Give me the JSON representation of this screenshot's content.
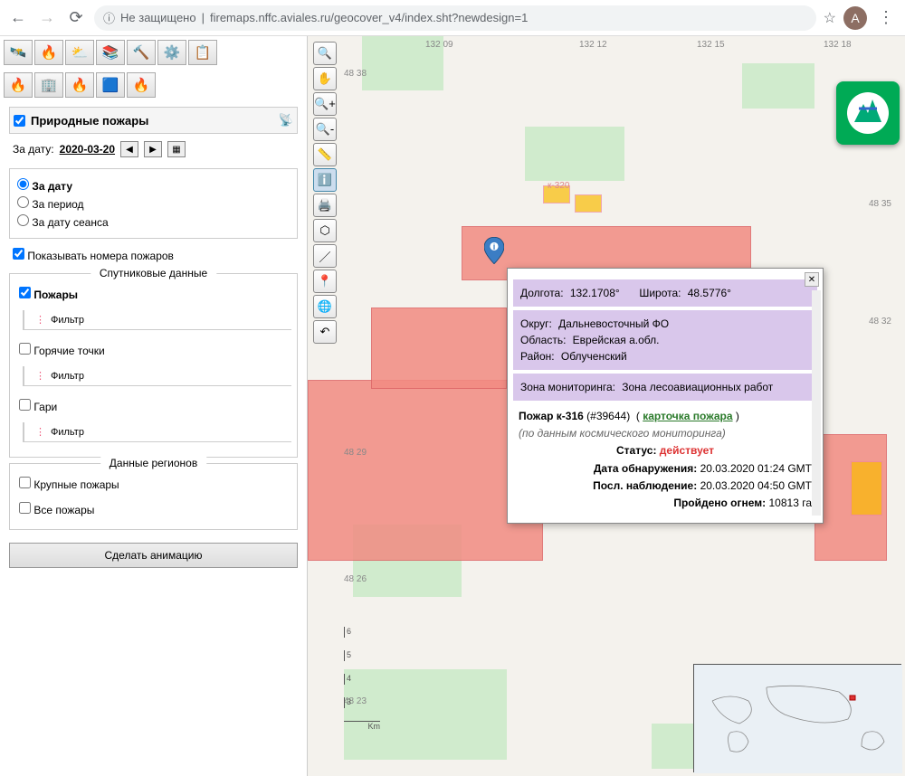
{
  "browser": {
    "security_text": "Не защищено",
    "url": "firemaps.nffc.aviales.ru/geocover_v4/index.sht?newdesign=1",
    "avatar_letter": "A"
  },
  "sidebar": {
    "wildfire_header": "Природные пожары",
    "date_label": "За дату:",
    "date_value": "2020-03-20",
    "radio_by_date": "За дату",
    "radio_by_period": "За период",
    "radio_by_session": "За дату сеанса",
    "show_numbers": "Показывать номера пожаров",
    "sat_data_title": "Спутниковые данные",
    "fires_label": "Пожары",
    "filter_label": "Фильтр",
    "hotspots_label": "Горячие точки",
    "burns_label": "Гари",
    "region_data_title": "Данные регионов",
    "big_fires": "Крупные пожары",
    "all_fires": "Все пожары",
    "make_animation": "Сделать анимацию"
  },
  "map": {
    "lon_labels": [
      "132 09",
      "132 12",
      "132 15",
      "132 18"
    ],
    "lat_labels": [
      "48 38",
      "48 35",
      "48 32",
      "48 29",
      "48 26",
      "48 23"
    ],
    "k320_label": "к-320",
    "scale_ticks": [
      "6",
      "5",
      "4",
      "3"
    ],
    "scale_km": "Km"
  },
  "popup": {
    "lon_label": "Долгота:",
    "lon_value": "132.1708°",
    "lat_label": "Широта:",
    "lat_value": "48.5776°",
    "okrug_label": "Округ:",
    "okrug_value": "Дальневосточный ФО",
    "oblast_label": "Область:",
    "oblast_value": "Еврейская а.обл.",
    "rayon_label": "Район:",
    "rayon_value": "Облученский",
    "zone_label": "Зона мониторинга:",
    "zone_value": "Зона лесоавиационных работ",
    "fire_name": "Пожар к-316",
    "fire_id": "(#39644)",
    "card_link": "карточка пожара",
    "sub_note": "(по данным космического мониторинга)",
    "status_label": "Статус:",
    "status_value": "действует",
    "detect_label": "Дата обнаружения:",
    "detect_value": "20.03.2020 01:24 GMT",
    "last_label": "Посл. наблюдение:",
    "last_value": "20.03.2020 04:50 GMT",
    "area_label": "Пройдено огнем:",
    "area_value": "10813 га"
  }
}
